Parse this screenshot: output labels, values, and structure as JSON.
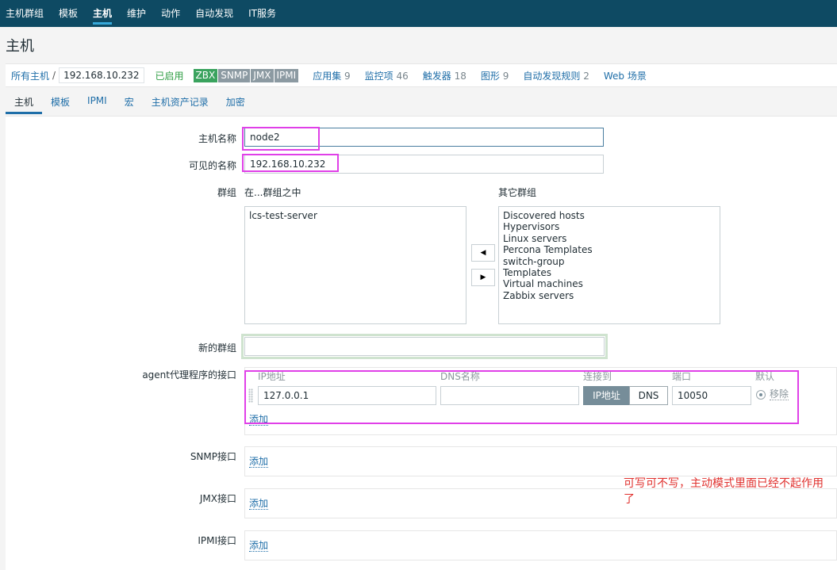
{
  "nav": {
    "items": [
      "主机群组",
      "模板",
      "主机",
      "维护",
      "动作",
      "自动发现",
      "IT服务"
    ],
    "active_index": 2
  },
  "page": {
    "title": "主机"
  },
  "breadcrumb": {
    "all_hosts": "所有主机",
    "separator": "/",
    "current_host": "192.168.10.232",
    "status": "已启用",
    "badges": [
      "ZBX",
      "SNMP",
      "JMX",
      "IPMI"
    ],
    "links": [
      {
        "label": "应用集",
        "count": "9"
      },
      {
        "label": "监控项",
        "count": "46"
      },
      {
        "label": "触发器",
        "count": "18"
      },
      {
        "label": "图形",
        "count": "9"
      },
      {
        "label": "自动发现规则",
        "count": "2"
      },
      {
        "label": "Web 场景",
        "count": ""
      }
    ]
  },
  "tabs": [
    "主机",
    "模板",
    "IPMI",
    "宏",
    "主机资产记录",
    "加密"
  ],
  "form": {
    "host_name_label": "主机名称",
    "host_name_value": "node2",
    "visible_name_label": "可见的名称",
    "visible_name_value": "192.168.10.232",
    "groups_label": "群组",
    "in_groups_label": "在...群组之中",
    "other_groups_label": "其它群组",
    "in_groups": [
      "lcs-test-server"
    ],
    "other_groups": [
      "Discovered hosts",
      "Hypervisors",
      "Linux servers",
      "Percona Templates",
      "switch-group",
      "Templates",
      "Virtual machines",
      "Zabbix servers"
    ],
    "arrow_left": "◀",
    "arrow_right": "▶",
    "new_group_label": "新的群组",
    "new_group_value": "",
    "agent_label": "agent代理程序的接口",
    "columns": {
      "ip": "IP地址",
      "dns": "DNS名称",
      "connect": "连接到",
      "port": "端口",
      "default": "默认"
    },
    "agent_ip": "127.0.0.1",
    "agent_dns": "",
    "connect_ip": "IP地址",
    "connect_dns": "DNS",
    "agent_port": "10050",
    "remove_label": "移除",
    "add_label": "添加",
    "snmp_label": "SNMP接口",
    "jmx_label": "JMX接口",
    "ipmi_label": "IPMI接口"
  },
  "annotation": {
    "note": "可写可不写，主动模式里面已经不起作用了",
    "color": "#e0312e",
    "box_color": "#e040e8"
  }
}
